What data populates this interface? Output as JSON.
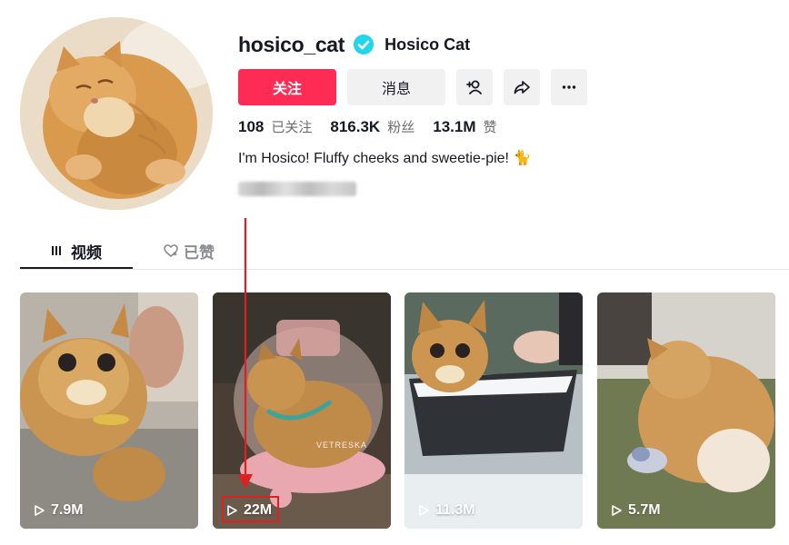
{
  "profile": {
    "username": "hosico_cat",
    "nickname": "Hosico Cat",
    "bio": "I'm Hosico! Fluffy cheeks and sweetie-pie! 🐈",
    "follow_label": "关注",
    "message_label": "消息"
  },
  "stats": {
    "following_count": "108",
    "following_label": "已关注",
    "followers_count": "816.3K",
    "followers_label": "粉丝",
    "likes_count": "13.1M",
    "likes_label": "赞"
  },
  "tabs": {
    "videos_label": "视频",
    "liked_label": "已赞"
  },
  "videos": [
    {
      "views": "7.9M"
    },
    {
      "views": "22M",
      "watermark": "VETRESKA"
    },
    {
      "views": "11.3M"
    },
    {
      "views": "5.7M"
    }
  ],
  "icons": {
    "verified": "verified-badge-icon",
    "add_friend": "add-friend-icon",
    "share": "share-icon",
    "more": "more-icon",
    "videos_tab": "grid-icon",
    "liked_tab": "heart-icon",
    "play": "play-icon"
  },
  "colors": {
    "follow_button": "#fe2c55",
    "verified_badge": "#20d5ec",
    "annotation": "#e02020"
  }
}
